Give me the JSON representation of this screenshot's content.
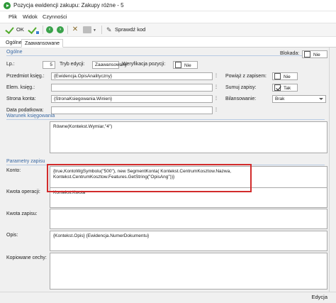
{
  "window": {
    "title": "Pozycja ewidencji zakupu: Zakupy różne - 5"
  },
  "menu": [
    "Plik",
    "Widok",
    "Czynności"
  ],
  "toolbar": {
    "ok_label": "OK",
    "check_label": "Sprawdź kod"
  },
  "tabs": [
    "Ogólne",
    "Zaawansowane"
  ],
  "sections": {
    "general": "Ogólne",
    "condition": "Warunek księgowania",
    "params": "Parametry zapisu"
  },
  "fields": {
    "lp_label": "Lp.:",
    "lp_value": "5",
    "tryb_label": "Tryb edycji:",
    "tryb_value": "Zaawansowany",
    "weryfikacja_label": "Weryfikacja pozycji:",
    "weryfikacja_value": "Nie",
    "blokada_label": "Blokada:",
    "blokada_value": "Nie",
    "przedmiot_label": "Przedmiot księg.:",
    "przedmiot_value": "{Ewidencja.OpisAnalityczny}",
    "elem_label": "Elem. księg.:",
    "elem_value": "",
    "strona_label": "Strona konta:",
    "strona_value": "{StronaKsiegowania.Winien}",
    "data_label": "Data podatkowa:",
    "data_value": "",
    "powiaz_label": "Powiąż z zapisem:",
    "powiaz_value": "Nie",
    "sumuj_label": "Sumuj zapisy:",
    "sumuj_value": "Tak",
    "bilans_label": "Bilansowanie:",
    "bilans_value": "Brak"
  },
  "condition_text": "Równe(Kontekst.Wymiar,\"4\")",
  "params": {
    "konto_label": "Konto:",
    "konto_line1": "{true,KontoWgSymbolu(\"500\"), new SegmentKonta( Kontekst.CentrumKosztow.Nazwa,",
    "konto_line2": "Kontekst.CentrumKosztow.Features.GetString(\"OpisAng\"))}",
    "kwota_op_label": "Kwota operacji:",
    "kwota_op_value": "Kontekst.Kwota",
    "kwota_zap_label": "Kwota zapisu:",
    "kwota_zap_value": "",
    "opis_label": "Opis:",
    "opis_value": "{Kontekst.Opis} {Ewidencja.NumerDokumentu}",
    "kop_label": "Kopiowane cechy:",
    "kop_value": ""
  },
  "status": {
    "mode": "Edycja"
  },
  "colors": {
    "accent_green": "#52ab2c",
    "highlight_red": "#d22b2b",
    "section_blue": "#3b6aa5"
  }
}
